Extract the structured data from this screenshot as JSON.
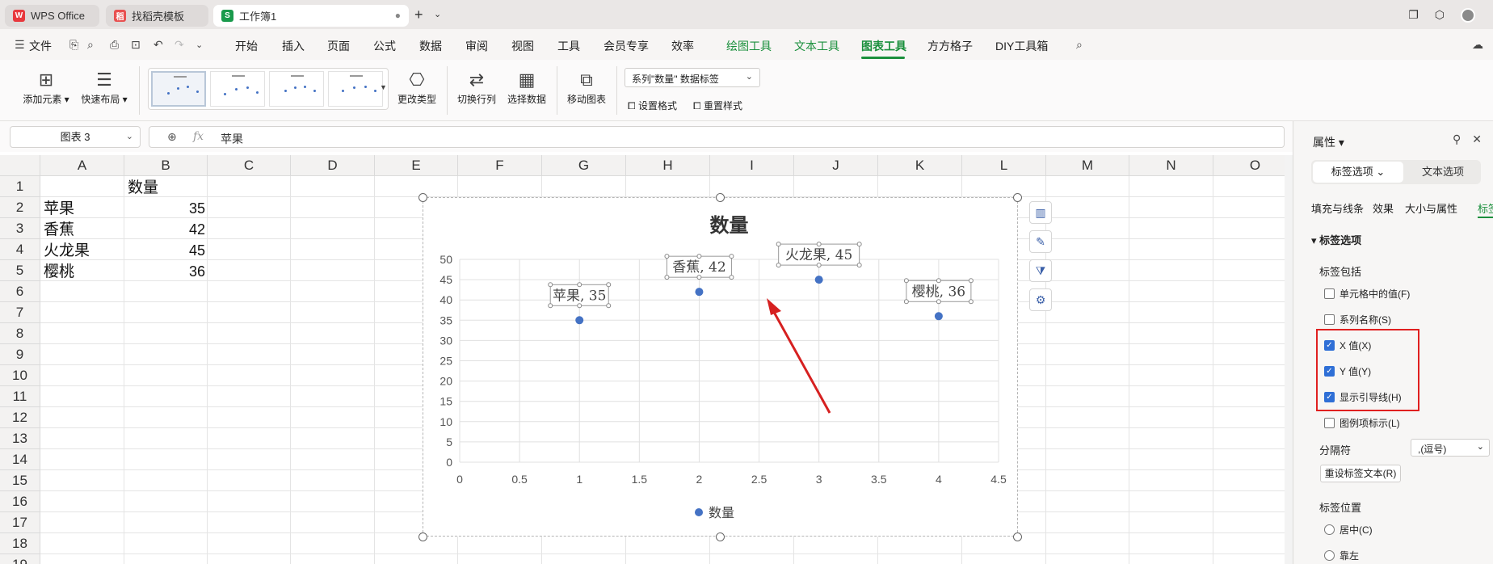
{
  "tabs": [
    {
      "label": "WPS Office",
      "icon": "wps-logo-icon"
    },
    {
      "label": "找稻壳模板",
      "icon": "docer-icon"
    },
    {
      "label": "工作簿1",
      "icon": "spreadsheet-icon",
      "close": "●"
    }
  ],
  "menu": {
    "file": "文件",
    "items": [
      "开始",
      "插入",
      "页面",
      "公式",
      "数据",
      "审阅",
      "视图",
      "工具",
      "会员专享",
      "效率"
    ],
    "context_items": [
      "绘图工具",
      "文本工具",
      "图表工具"
    ],
    "extra_items": [
      "方方格子",
      "DIY工具箱"
    ]
  },
  "ribbon": {
    "add_element": "添加元素",
    "quick_layout": "快速布局",
    "change_type": "更改类型",
    "switch_row_col": "切换行列",
    "select_data": "选择数据",
    "move_chart": "移动图表",
    "series_dropdown": "系列\"数量\" 数据标签",
    "set_format": "设置格式",
    "reset_style": "重置样式"
  },
  "formula_bar": {
    "name_box": "图表 3",
    "fx": "fx",
    "value": "苹果"
  },
  "sheet": {
    "columns": [
      "A",
      "B",
      "C",
      "D",
      "E",
      "F",
      "G",
      "H",
      "I",
      "J",
      "K",
      "L",
      "M",
      "N",
      "O"
    ],
    "rows": [
      "1",
      "2",
      "3",
      "4",
      "5",
      "6",
      "7",
      "8",
      "9",
      "10",
      "11",
      "12",
      "13",
      "14",
      "15",
      "16",
      "17",
      "18",
      "19"
    ],
    "header_b1": "数量",
    "data": [
      {
        "name": "苹果",
        "value": "35"
      },
      {
        "name": "香蕉",
        "value": "42"
      },
      {
        "name": "火龙果",
        "value": "45"
      },
      {
        "name": "樱桃",
        "value": "36"
      }
    ]
  },
  "chart_data": {
    "type": "scatter",
    "title": "数量",
    "x": [
      1,
      2,
      3,
      4
    ],
    "y": [
      35,
      42,
      45,
      36
    ],
    "point_labels": [
      "苹果, 35",
      "香蕉, 42",
      "火龙果, 45",
      "樱桃, 36"
    ],
    "series": [
      {
        "name": "数量",
        "color": "#4472c4"
      }
    ],
    "xlim": [
      0,
      4.5
    ],
    "ylim": [
      0,
      50
    ],
    "xticks": [
      "0",
      "0.5",
      "1",
      "1.5",
      "2",
      "2.5",
      "3",
      "3.5",
      "4",
      "4.5"
    ],
    "yticks": [
      "0",
      "5",
      "10",
      "15",
      "20",
      "25",
      "30",
      "35",
      "40",
      "45",
      "50"
    ],
    "grid": true,
    "legend": "bottom",
    "arrow_color": "#d62020"
  },
  "panel": {
    "title": "属性",
    "seg_label_options": "标签选项",
    "seg_text_options": "文本选项",
    "subtabs": [
      "填充与线条",
      "效果",
      "大小与属性",
      "标签"
    ],
    "section_label_options": "标签选项",
    "label_contains": "标签包括",
    "checkboxes": [
      {
        "label": "单元格中的值(F)",
        "checked": false
      },
      {
        "label": "系列名称(S)",
        "checked": false
      },
      {
        "label": "X 值(X)",
        "checked": true
      },
      {
        "label": "Y 值(Y)",
        "checked": true
      },
      {
        "label": "显示引导线(H)",
        "checked": true
      },
      {
        "label": "图例项标示(L)",
        "checked": false
      }
    ],
    "separator_label": "分隔符",
    "separator_value": ",(逗号)",
    "reset_label_text": "重设标签文本(R)",
    "label_position": "标签位置",
    "positions": [
      "居中(C)",
      "靠左"
    ]
  }
}
